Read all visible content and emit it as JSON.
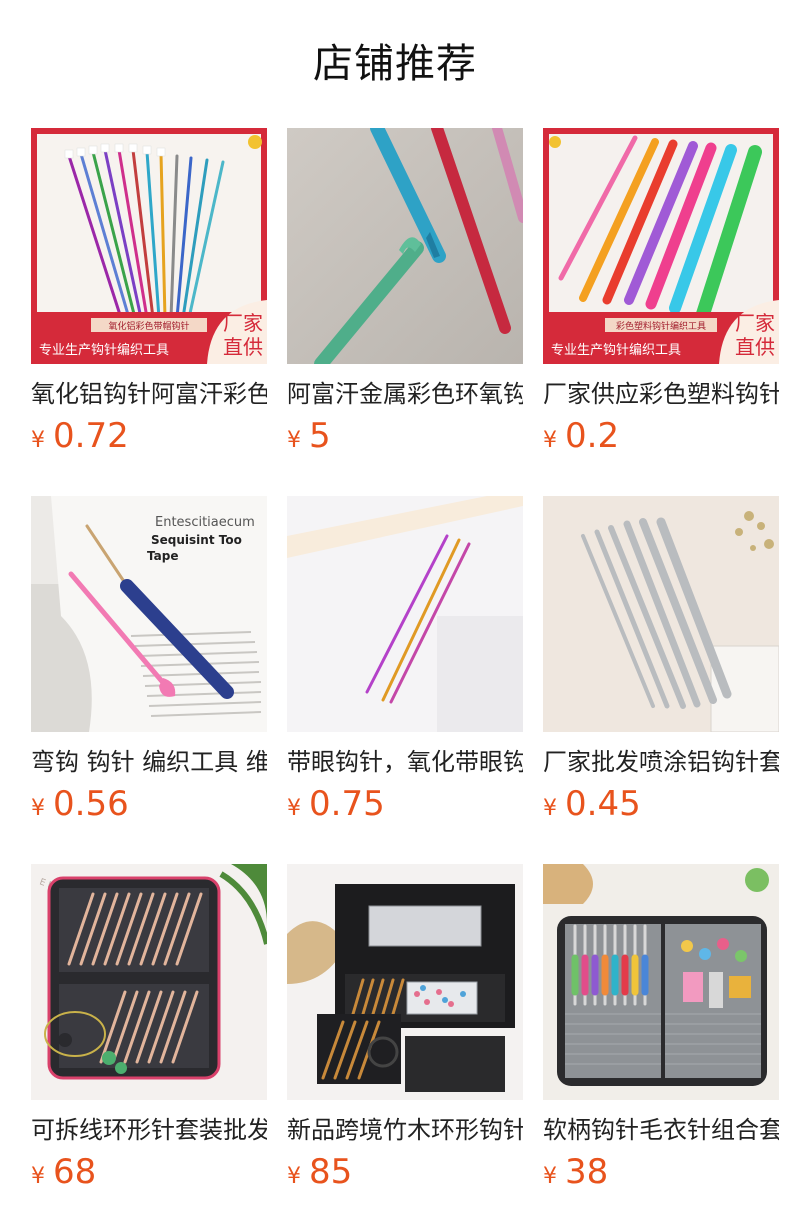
{
  "page": {
    "title": "店铺推荐",
    "accent_color": "#e8531d"
  },
  "products": [
    {
      "name": "氧化铝钩针阿富汗彩色带帽钩针",
      "currency": "¥",
      "price": "0.72",
      "image": "colorful-aluminum-crochet-hooks",
      "badge_top": "氧化铝彩色带帽钩针",
      "badge_bottom": "专业生产钩针编织工具",
      "badge_corner": [
        "厂家",
        "直供"
      ]
    },
    {
      "name": "阿富汗金属彩色环氧钩针",
      "currency": "¥",
      "price": "5",
      "image": "metallic-crochet-hooks-closeup"
    },
    {
      "name": "厂家供应彩色塑料钩针",
      "currency": "¥",
      "price": "0.2",
      "image": "plastic-crochet-hooks",
      "badge_top": "彩色塑料钩针编织工具",
      "badge_bottom": "专业生产钩针编织工具",
      "badge_corner": [
        "厂家",
        "直供"
      ]
    },
    {
      "name": "弯钩 钩针 编织工具 维修",
      "currency": "¥",
      "price": "0.56",
      "image": "bent-hook-tool-on-book",
      "photo_text": [
        "Entescitiaecum",
        "Sequisint Too",
        "Tape"
      ]
    },
    {
      "name": "带眼钩针，氧化带眼钩针",
      "currency": "¥",
      "price": "0.75",
      "image": "eyed-crochet-hooks"
    },
    {
      "name": "厂家批发喷涂铝钩针套装",
      "currency": "¥",
      "price": "0.45",
      "image": "grey-aluminum-crochet-set"
    },
    {
      "name": "可拆线环形针套装批发",
      "currency": "¥",
      "price": "68",
      "image": "interchangeable-circular-needle-kit",
      "photo_text": [
        "E ISENG"
      ]
    },
    {
      "name": "新品跨境竹木环形钩针套装",
      "currency": "¥",
      "price": "85",
      "image": "bamboo-circular-needle-box"
    },
    {
      "name": "软柄钩针毛衣针组合套装",
      "currency": "¥",
      "price": "38",
      "image": "soft-handle-crochet-kit-case"
    }
  ]
}
